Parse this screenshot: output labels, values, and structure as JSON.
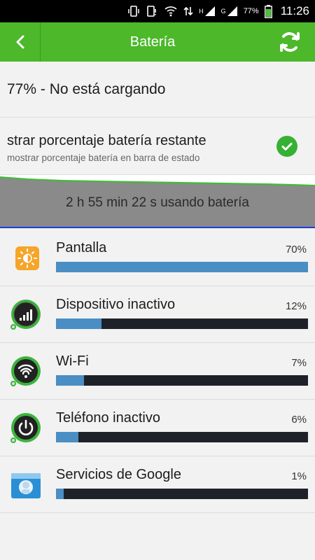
{
  "status_bar": {
    "battery_percent": "77%",
    "time": "11:26",
    "net_1": "H",
    "net_2": "G"
  },
  "app_bar": {
    "title": "Batería"
  },
  "charge_status": "77% - No está cargando",
  "toggle": {
    "title": "strar porcentaje batería restante",
    "subtitle": "mostrar porcentaje batería en barra de estado",
    "checked": true
  },
  "graph": {
    "usage_text": "2 h 55 min 22 s usando batería"
  },
  "usage_items": [
    {
      "name": "Pantalla",
      "percent_label": "70%",
      "fraction": 1.0,
      "icon": "brightness-icon"
    },
    {
      "name": "Dispositivo inactivo",
      "percent_label": "12%",
      "fraction": 0.18,
      "icon": "signal-bars-icon"
    },
    {
      "name": "Wi-Fi",
      "percent_label": "7%",
      "fraction": 0.11,
      "icon": "wifi-icon"
    },
    {
      "name": "Teléfono inactivo",
      "percent_label": "6%",
      "fraction": 0.09,
      "icon": "power-icon"
    },
    {
      "name": "Servicios de Google",
      "percent_label": "1%",
      "fraction": 0.03,
      "icon": "google-services-icon"
    }
  ]
}
